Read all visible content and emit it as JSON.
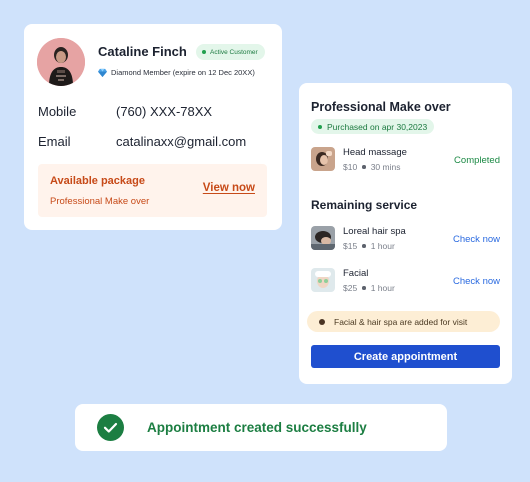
{
  "profile": {
    "name": "Cataline Finch",
    "status_badge": "Active Customer",
    "membership": "Diamond Member (expire on 12 Dec 20XX)",
    "avatar_icon": "user-avatar",
    "fields": [
      {
        "label": "Mobile",
        "value": "(760) XXX-78XX"
      },
      {
        "label": "Email",
        "value": "catalinaxx@gmail.com"
      }
    ],
    "package": {
      "title": "Available package",
      "name": "Professional Make over",
      "link": "View now"
    }
  },
  "service": {
    "title": "Professional Make over",
    "purchased": "Purchased on apr 30,2023",
    "completed_item": {
      "name": "Head massage",
      "price": "$10",
      "duration": "30 mins",
      "status": "Completed",
      "icon": "head-massage-thumbnail"
    },
    "remaining_title": "Remaining service",
    "remaining": [
      {
        "name": "Loreal hair spa",
        "price": "$15",
        "duration": "1 hour",
        "action": "Check now",
        "icon": "hair-spa-thumbnail"
      },
      {
        "name": "Facial",
        "price": "$25",
        "duration": "1 hour",
        "action": "Check now",
        "icon": "facial-thumbnail"
      }
    ],
    "note": "Facial & hair spa are added for visit",
    "button": "Create appointment"
  },
  "toast": {
    "message": "Appointment created successfully",
    "icon": "check-circle-icon"
  },
  "colors": {
    "background": "#cfe2fb",
    "accent_blue": "#1f4fcf",
    "success_green": "#1c7e42",
    "package_orange": "#c74a18"
  }
}
